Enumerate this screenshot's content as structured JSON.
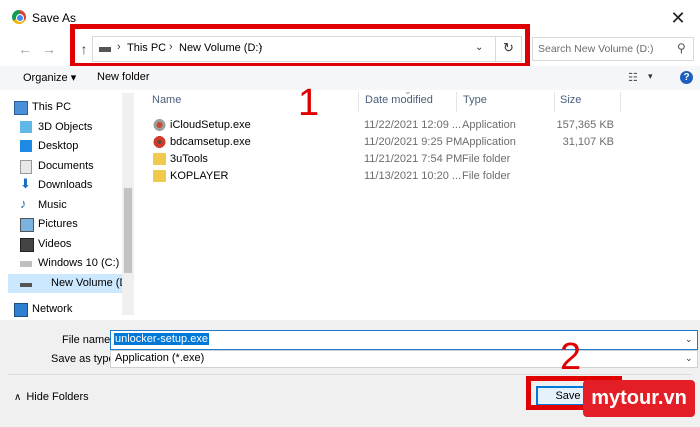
{
  "window": {
    "title": "Save As",
    "close_glyph": "✕",
    "logo": "chrome-logo"
  },
  "nav": {
    "back_glyph": "←",
    "forward_glyph": "→",
    "up_glyph": "↑",
    "breadcrumbs": [
      "This PC",
      "New Volume (D:)"
    ],
    "separator": "›",
    "dropdown_glyph": "⌄",
    "refresh_glyph": "↻",
    "search_placeholder": "Search New Volume (D:)",
    "search_glyph": "⚲"
  },
  "toolbar": {
    "organize": "Organize ▾",
    "new_folder": "New folder",
    "view_glyph": "☷",
    "view_dd": "▾",
    "help": "?"
  },
  "sidebar": {
    "items": [
      {
        "label": "This PC",
        "icon": "pc-icon"
      },
      {
        "label": "3D Objects",
        "icon": "cube-icon"
      },
      {
        "label": "Desktop",
        "icon": "desktop-icon"
      },
      {
        "label": "Documents",
        "icon": "document-icon"
      },
      {
        "label": "Downloads",
        "icon": "download-icon"
      },
      {
        "label": "Music",
        "icon": "music-icon"
      },
      {
        "label": "Pictures",
        "icon": "picture-icon"
      },
      {
        "label": "Videos",
        "icon": "video-icon"
      },
      {
        "label": "Windows 10 (C:)",
        "icon": "drive-icon"
      },
      {
        "label": "New Volume (D:)",
        "icon": "drive-icon",
        "selected": true
      },
      {
        "label": "Network",
        "icon": "network-icon"
      }
    ]
  },
  "columns": {
    "name": "Name",
    "date": "Date modified",
    "type": "Type",
    "size": "Size"
  },
  "files": [
    {
      "name": "iCloudSetup.exe",
      "date": "11/22/2021 12:09 ...",
      "type": "Application",
      "size": "157,365 KB",
      "icon": "exe-icon"
    },
    {
      "name": "bdcamsetup.exe",
      "date": "11/20/2021 9:25 PM",
      "type": "Application",
      "size": "31,107 KB",
      "icon": "exe-icon"
    },
    {
      "name": "3uTools",
      "date": "11/21/2021 7:54 PM",
      "type": "File folder",
      "size": "",
      "icon": "folder-icon"
    },
    {
      "name": "KOPLAYER",
      "date": "11/13/2021 10:20 ...",
      "type": "File folder",
      "size": "",
      "icon": "folder-icon"
    }
  ],
  "form": {
    "file_name_label": "File name:",
    "file_name_value": "unlocker-setup.exe",
    "type_label": "Save as type:",
    "type_value": "Application (*.exe)",
    "dropdown_glyph": "⌄"
  },
  "footer": {
    "hide_folders": "Hide Folders",
    "hide_chevron": "∧",
    "save": "Save"
  },
  "annotations": {
    "marker_1": "1",
    "marker_2": "2",
    "accent": "#e00000"
  },
  "watermark": "mytour.vn"
}
